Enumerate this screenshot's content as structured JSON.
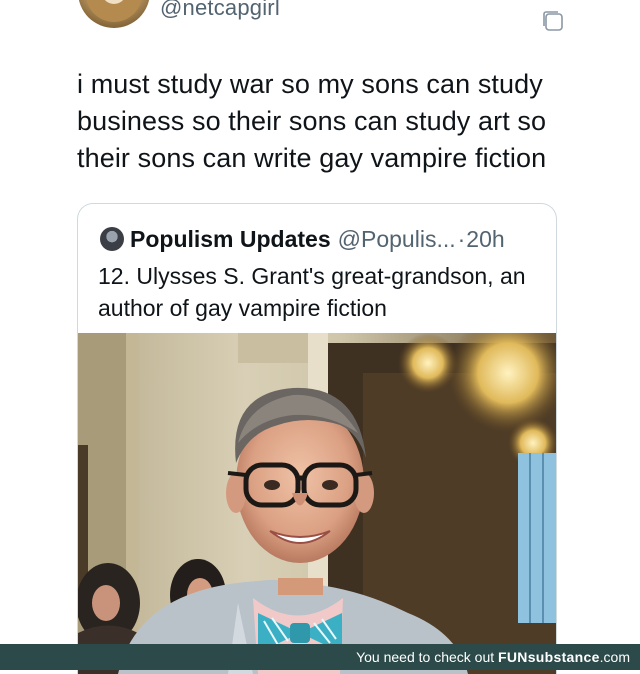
{
  "author": {
    "handle": "@netcapgirl"
  },
  "tweet": {
    "text": "i must study war so my sons can study business so their sons can study art so their sons can write gay vampire fiction"
  },
  "quote": {
    "name": "Populism Updates",
    "handle": "@Populis...",
    "separator": "·",
    "time": "20h",
    "text": "12. Ulysses S. Grant's great-grandson, an author of gay vampire fiction"
  },
  "photo": {
    "description_icon": "photo-of-man-with-glasses-and-bow-tie"
  },
  "watermark": {
    "prefix": "You need to check out ",
    "brand": "FUNsubstance",
    "suffix": ".com"
  },
  "colors": {
    "text": "#0f1419",
    "muted": "#536471",
    "border": "#cfd9de",
    "bar": "#2b4a49"
  }
}
